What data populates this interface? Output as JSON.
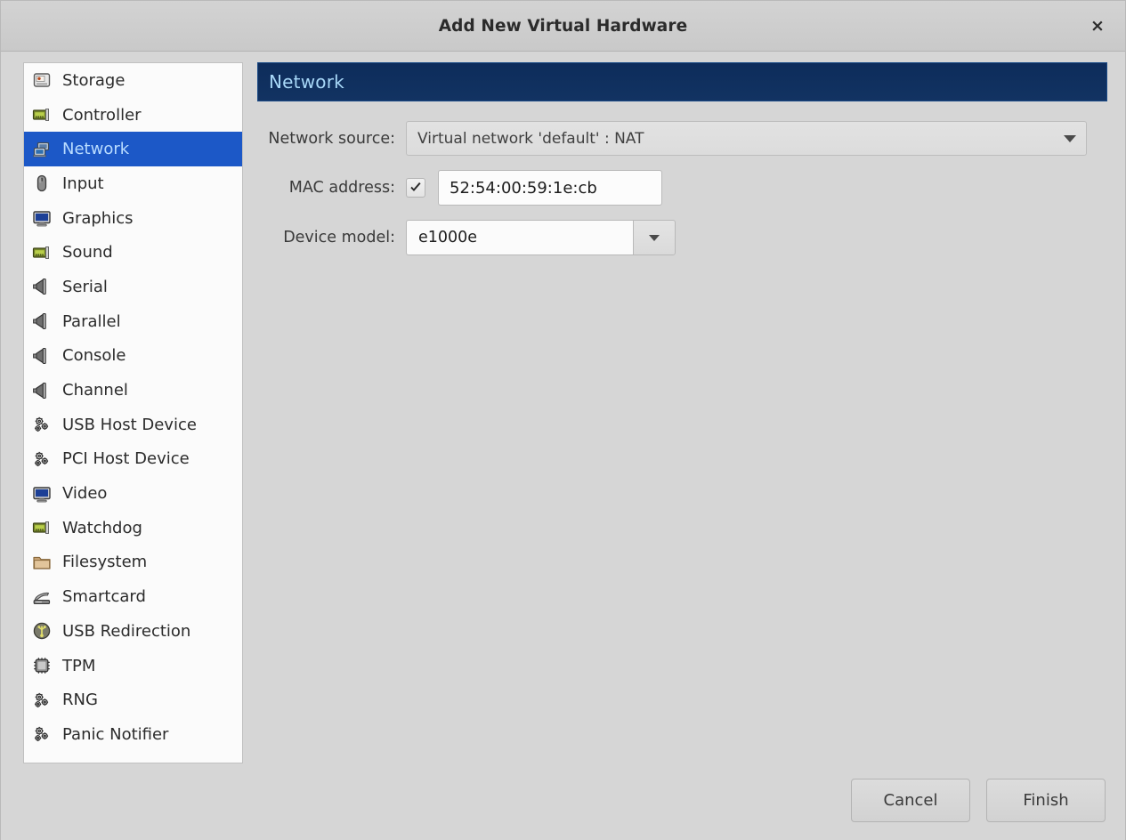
{
  "window": {
    "title": "Add New Virtual Hardware",
    "close_label": "×"
  },
  "sidebar": {
    "selected": "Network",
    "items": [
      {
        "label": "Storage",
        "icon": "storage-icon"
      },
      {
        "label": "Controller",
        "icon": "controller-card-icon"
      },
      {
        "label": "Network",
        "icon": "network-icon"
      },
      {
        "label": "Input",
        "icon": "mouse-icon"
      },
      {
        "label": "Graphics",
        "icon": "monitor-icon"
      },
      {
        "label": "Sound",
        "icon": "sound-card-icon"
      },
      {
        "label": "Serial",
        "icon": "plug-icon"
      },
      {
        "label": "Parallel",
        "icon": "plug-icon"
      },
      {
        "label": "Console",
        "icon": "plug-icon"
      },
      {
        "label": "Channel",
        "icon": "plug-icon"
      },
      {
        "label": "USB Host Device",
        "icon": "gears-icon"
      },
      {
        "label": "PCI Host Device",
        "icon": "gears-icon"
      },
      {
        "label": "Video",
        "icon": "monitor-icon"
      },
      {
        "label": "Watchdog",
        "icon": "controller-card-icon"
      },
      {
        "label": "Filesystem",
        "icon": "folder-icon"
      },
      {
        "label": "Smartcard",
        "icon": "smartcard-reader-icon"
      },
      {
        "label": "USB Redirection",
        "icon": "usb-icon"
      },
      {
        "label": "TPM",
        "icon": "chip-icon"
      },
      {
        "label": "RNG",
        "icon": "gears-icon"
      },
      {
        "label": "Panic Notifier",
        "icon": "gears-icon"
      }
    ]
  },
  "pane": {
    "header_title": "Network",
    "fields": {
      "network_source_label": "Network source:",
      "network_source_value": "Virtual network 'default' : NAT",
      "mac_address_label": "MAC address:",
      "mac_address_value": "52:54:00:59:1e:cb",
      "mac_address_checked": true,
      "device_model_label": "Device model:",
      "device_model_value": "e1000e"
    }
  },
  "footer": {
    "cancel_label": "Cancel",
    "finish_label": "Finish"
  },
  "colors": {
    "selection_blue": "#1c58c7",
    "header_navy": "#0d2c5b",
    "header_text": "#a8d8f8",
    "window_bg": "#d6d6d6"
  }
}
